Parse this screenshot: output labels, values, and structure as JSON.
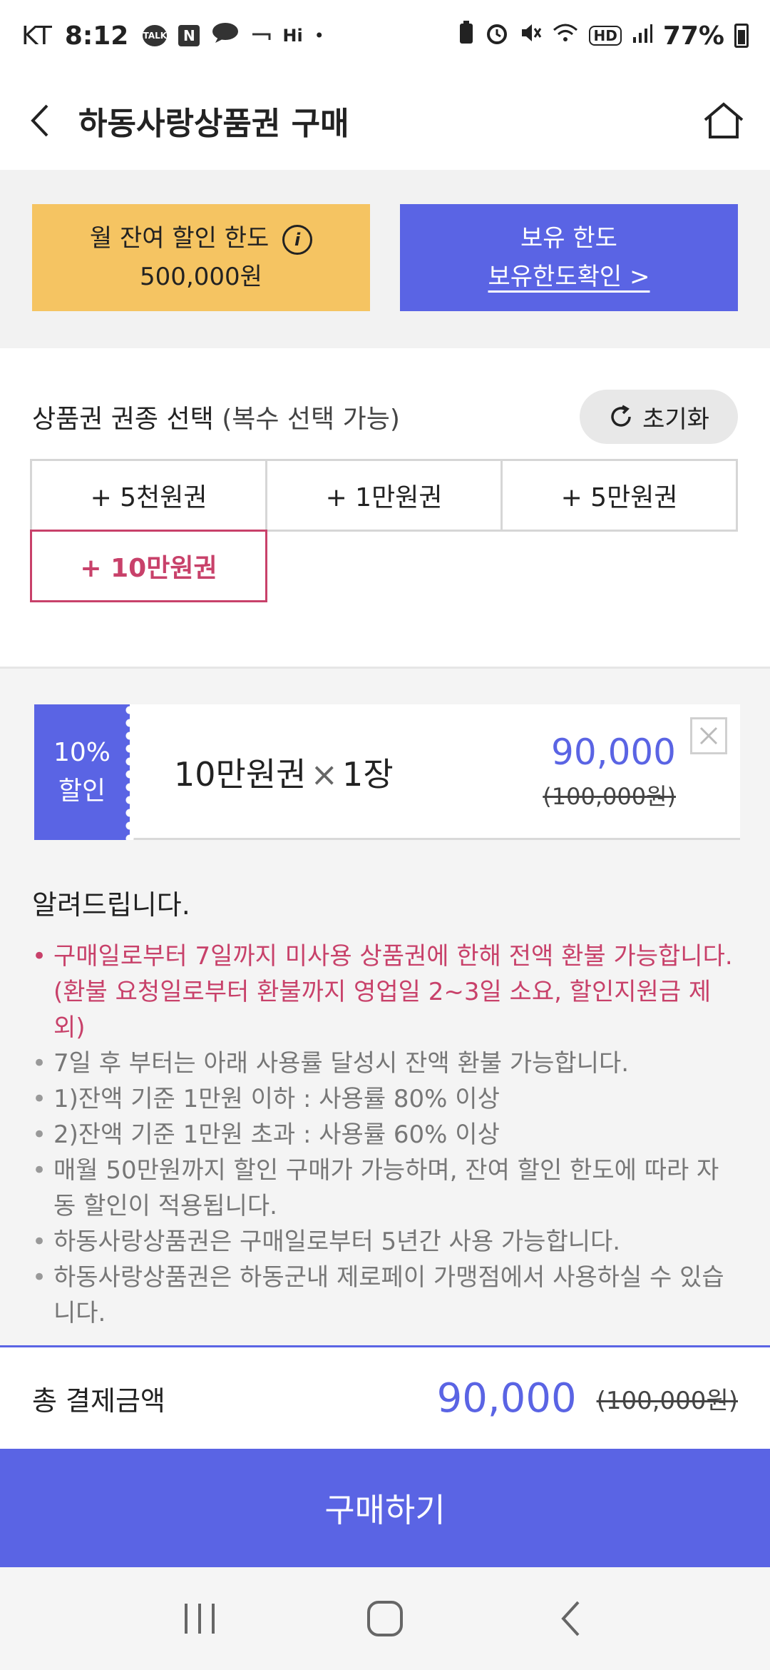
{
  "status_bar": {
    "carrier": "KT",
    "time": "8:12",
    "notif_icons": [
      "TALK",
      "N"
    ],
    "hi_label": "Hi",
    "hd_label": "HD",
    "battery_percent": "77%"
  },
  "header": {
    "title": "하동사랑상품권 구매"
  },
  "limits": {
    "monthly_label": "월 잔여 할인 한도",
    "monthly_value": "500,000원",
    "hold_label": "보유 한도",
    "hold_link": "보유한도확인 >"
  },
  "selection": {
    "title": "상품권 권종 선택",
    "subtitle": "(복수 선택 가능)",
    "reset_label": "초기화",
    "options": [
      "+ 5천원권",
      "+ 1만원권",
      "+ 5만원권",
      "+ 10만원권"
    ],
    "selected_index": 3
  },
  "cart": {
    "discount_rate": "10%",
    "discount_label": "할인",
    "item_name": "10만원권",
    "times_sign": "×",
    "item_qty": "1장",
    "price": "90,000",
    "original_price": "(100,000원)"
  },
  "notice": {
    "title": "알려드립니다.",
    "items": [
      "구매일로부터 7일까지 미사용 상품권에 한해 전액 환불 가능합니다.(환불 요청일로부터 환불까지 영업일 2~3일 소요, 할인지원금 제외)",
      "7일 후 부터는 아래 사용률 달성시 잔액 환불 가능합니다.",
      "1)잔액 기준 1만원 이하 : 사용률 80% 이상",
      "2)잔액 기준 1만원 초과 : 사용률 60% 이상",
      "매월 50만원까지 할인 구매가 가능하며, 잔여 할인 한도에 따라 자동 할인이 적용됩니다.",
      "하동사랑상품권은 구매일로부터 5년간 사용 가능합니다.",
      "하동사랑상품권은 하동군내 제로페이 가맹점에서 사용하실 수 있습니다."
    ]
  },
  "total": {
    "label": "총 결제금액",
    "price": "90,000",
    "original_price": "(100,000원)"
  },
  "buy_button": "구매하기",
  "colors": {
    "accent": "#5a64e4",
    "yellow": "#f5c462",
    "highlight": "#c8416a"
  }
}
